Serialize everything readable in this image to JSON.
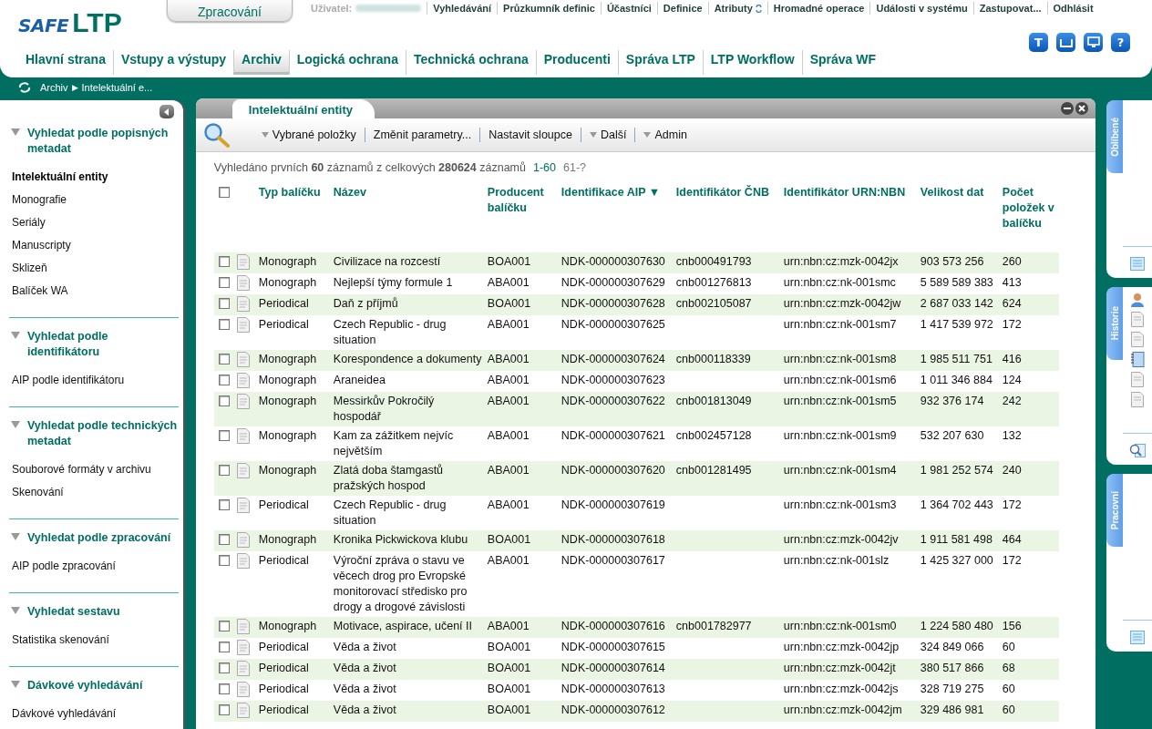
{
  "logo": {
    "part1": "SAFE",
    "part2": "LTP"
  },
  "processing_button": "Zpracování",
  "user_label": "Uživatel:",
  "top_links": [
    {
      "label": "Vyhledávání",
      "icon": false
    },
    {
      "label": "Průzkumník definic",
      "icon": false
    },
    {
      "label": "Účastníci",
      "icon": false
    },
    {
      "label": "Definice",
      "icon": false
    },
    {
      "label": "Atributy",
      "icon": true
    },
    {
      "label": "Hromadné operace",
      "icon": false
    },
    {
      "label": "Události v systému",
      "icon": false
    },
    {
      "label": "Zastupovat...",
      "icon": false
    },
    {
      "label": "Odhlásit",
      "icon": false
    }
  ],
  "header_icons": [
    {
      "kind": "text",
      "label": "T"
    },
    {
      "kind": "keyboard"
    },
    {
      "kind": "monitor"
    },
    {
      "kind": "text",
      "label": "?"
    }
  ],
  "nav_tabs": [
    {
      "label": "Hlavní strana",
      "selected": false
    },
    {
      "label": "Vstupy a výstupy",
      "selected": false
    },
    {
      "label": "Archiv",
      "selected": true
    },
    {
      "label": "Logická ochrana",
      "selected": false
    },
    {
      "label": "Technická ochrana",
      "selected": false
    },
    {
      "label": "Producenti",
      "selected": false
    },
    {
      "label": "Správa LTP",
      "selected": false
    },
    {
      "label": "LTP Workflow",
      "selected": false
    },
    {
      "label": "Správa WF",
      "selected": false
    }
  ],
  "breadcrumb": {
    "items": [
      "Archiv",
      "Intelektuální e..."
    ],
    "separator": "▶"
  },
  "sidebar": [
    {
      "title": "Vyhledat podle popisných metadat",
      "items": [
        {
          "label": "Intelektuální entity",
          "selected": true
        },
        {
          "label": "Monografie",
          "selected": false
        },
        {
          "label": "Seriály",
          "selected": false
        },
        {
          "label": "Manuscripty",
          "selected": false
        },
        {
          "label": "Sklizeň",
          "selected": false
        },
        {
          "label": "Balíček WA",
          "selected": false
        }
      ]
    },
    {
      "title": "Vyhledat podle identifikátoru",
      "items": [
        {
          "label": "AIP podle identifikátoru",
          "selected": false
        }
      ]
    },
    {
      "title": "Vyhledat podle technických metadat",
      "items": [
        {
          "label": "Souborové formáty v archivu",
          "selected": false
        },
        {
          "label": "Skenování",
          "selected": false
        }
      ]
    },
    {
      "title": "Vyhledat podle zpracování",
      "items": [
        {
          "label": "AIP podle zpracování",
          "selected": false
        }
      ]
    },
    {
      "title": "Vyhledat sestavu",
      "items": [
        {
          "label": "Statistika skenování",
          "selected": false
        }
      ]
    },
    {
      "title": "Dávkové vyhledávání",
      "items": [
        {
          "label": "Dávkové vyhledávání",
          "selected": false
        }
      ]
    }
  ],
  "panel": {
    "tab": "Intelektuální entity",
    "toolbar": [
      {
        "label": "Vybrané položky",
        "dropdown": true
      },
      {
        "label": "Změnit parametry...",
        "dropdown": false
      },
      {
        "label": "Nastavit sloupce",
        "dropdown": false
      },
      {
        "label": "Další",
        "dropdown": true
      },
      {
        "label": "Admin",
        "dropdown": true
      }
    ],
    "summary": "Vyhledáno prvních **60** záznamů z celkových **280624** záznamů",
    "pages": [
      {
        "label": "1-60",
        "disabled": false
      },
      {
        "label": "61-?",
        "disabled": true
      }
    ],
    "table": {
      "select_all_checked": false,
      "columns": [
        "Typ balíčku",
        "Název",
        "Producent balíčku",
        "Identifikace AIP ▼",
        "Identifikátor ČNB",
        "Identifikátor URN:NBN",
        "Velikost dat",
        "Počet položek v balíčku"
      ],
      "rows": [
        {
          "checked": false,
          "cells": [
            "Monograph",
            "Civilizace na rozcestí",
            "BOA001",
            "NDK-000000307630",
            "cnb000491793",
            "urn:nbn:cz:mzk-0042jx",
            "903 573 256",
            "260"
          ]
        },
        {
          "checked": false,
          "cells": [
            "Monograph",
            "Nejlepší týmy formule 1",
            "ABA001",
            "NDK-000000307629",
            "cnb001276813",
            "urn:nbn:cz:nk-001smc",
            "5 589 589 383",
            "413"
          ]
        },
        {
          "checked": false,
          "cells": [
            "Periodical",
            "Daň z příjmů",
            "BOA001",
            "NDK-000000307628",
            "cnb002105087",
            "urn:nbn:cz:mzk-0042jw",
            "2 687 033 142",
            "624"
          ]
        },
        {
          "checked": false,
          "cells": [
            "Periodical",
            "Czech Republic - drug situation",
            "ABA001",
            "NDK-000000307625",
            "",
            "urn:nbn:cz:nk-001sm7",
            "1 417 539 972",
            "172"
          ]
        },
        {
          "checked": false,
          "cells": [
            "Monograph",
            "Korespondence a dokumenty",
            "ABA001",
            "NDK-000000307624",
            "cnb000118339",
            "urn:nbn:cz:nk-001sm8",
            "1 985 511 751",
            "416"
          ]
        },
        {
          "checked": false,
          "cells": [
            "Monograph",
            "Araneidea",
            "ABA001",
            "NDK-000000307623",
            "",
            "urn:nbn:cz:nk-001sm6",
            "1 011 346 884",
            "124"
          ]
        },
        {
          "checked": false,
          "cells": [
            "Monograph",
            "Messirkův Pokročilý hospodář",
            "ABA001",
            "NDK-000000307622",
            "cnb001813049",
            "urn:nbn:cz:nk-001sm5",
            "932 376 174",
            "242"
          ]
        },
        {
          "checked": false,
          "cells": [
            "Monograph",
            "Kam za zážitkem nejvíc největším",
            "ABA001",
            "NDK-000000307621",
            "cnb002457128",
            "urn:nbn:cz:nk-001sm9",
            "532 207 630",
            "132"
          ]
        },
        {
          "checked": false,
          "cells": [
            "Monograph",
            "Zlatá doba štamgastů pražských hospod",
            "ABA001",
            "NDK-000000307620",
            "cnb001281495",
            "urn:nbn:cz:nk-001sm4",
            "1 981 252 574",
            "240"
          ]
        },
        {
          "checked": false,
          "cells": [
            "Periodical",
            "Czech Republic - drug situation",
            "ABA001",
            "NDK-000000307619",
            "",
            "urn:nbn:cz:nk-001sm3",
            "1 364 702 443",
            "172"
          ]
        },
        {
          "checked": false,
          "cells": [
            "Monograph",
            "Kronika Pickwickova klubu",
            "BOA001",
            "NDK-000000307618",
            "",
            "urn:nbn:cz:mzk-0042jv",
            "1 911 581 498",
            "464"
          ]
        },
        {
          "checked": false,
          "cells": [
            "Periodical",
            "Výroční zpráva o stavu ve věcech drog pro Evropské monitorovací středisko pro drogy a drogové závislosti",
            "ABA001",
            "NDK-000000307617",
            "",
            "urn:nbn:cz:nk-001slz",
            "1 425 327 000",
            "172"
          ]
        },
        {
          "checked": false,
          "cells": [
            "Monograph",
            "Motivace, aspirace, učení II",
            "ABA001",
            "NDK-000000307616",
            "cnb001782977",
            "urn:nbn:cz:nk-001sm0",
            "1 224 580 480",
            "156"
          ]
        },
        {
          "checked": false,
          "cells": [
            "Periodical",
            "Věda a život",
            "BOA001",
            "NDK-000000307615",
            "",
            "urn:nbn:cz:mzk-0042jp",
            "324 849 066",
            "60"
          ]
        },
        {
          "checked": false,
          "cells": [
            "Periodical",
            "Věda a život",
            "BOA001",
            "NDK-000000307614",
            "",
            "urn:nbn:cz:mzk-0042jt",
            "380 517 866",
            "68"
          ]
        },
        {
          "checked": false,
          "cells": [
            "Periodical",
            "Věda a život",
            "BOA001",
            "NDK-000000307613",
            "",
            "urn:nbn:cz:mzk-0042js",
            "328 719 275",
            "60"
          ]
        },
        {
          "checked": false,
          "cells": [
            "Periodical",
            "Věda a život",
            "BOA001",
            "NDK-000000307612",
            "",
            "urn:nbn:cz:mzk-0042jm",
            "329 486 981",
            "60"
          ]
        }
      ]
    }
  },
  "side_panels": [
    {
      "label": "Oblíbené"
    },
    {
      "label": "Historie"
    },
    {
      "label": "Pracovní"
    }
  ]
}
